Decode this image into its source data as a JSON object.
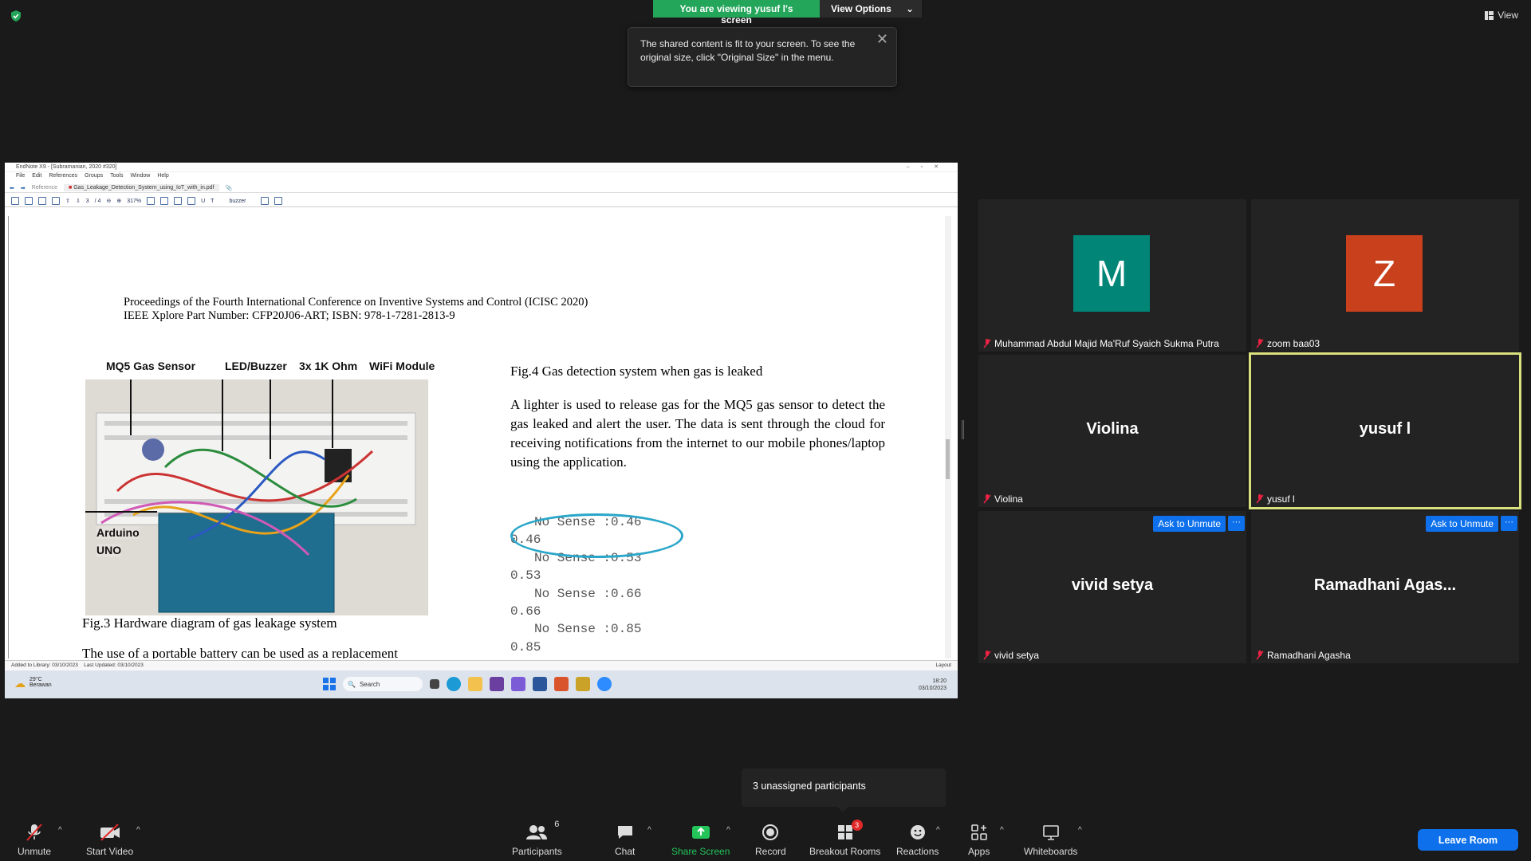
{
  "banner": {
    "viewing": "You are viewing yusuf l's screen",
    "view_options": "View Options"
  },
  "view_label": "View",
  "tooltip": {
    "text": "The shared content is fit to your screen. To see the original size, click \"Original Size\" in the menu."
  },
  "endnote": {
    "title": "EndNote X9 - [Subramanian, 2020 #320]",
    "menu": [
      "File",
      "Edit",
      "References",
      "Groups",
      "Tools",
      "Window",
      "Help"
    ],
    "tab_reference": "Reference",
    "tab_pdf": "Gas_Leakage_Detection_System_using_IoT_with_in.pdf",
    "page_current": "3",
    "page_total": "/ 4",
    "zoom": "317%",
    "search_text": "buzzer",
    "status_added": "Added to Library: 03/10/2023",
    "status_updated": "Last Updated: 03/10/2023",
    "layout": "Layout"
  },
  "pdf": {
    "header_line1": "Proceedings of the Fourth International Conference on Inventive Systems and Control (ICISC 2020)",
    "header_line2": "IEEE Xplore Part Number: CFP20J06-ART; ISBN: 978-1-7281-2813-9",
    "label_mq5": "MQ5 Gas Sensor",
    "label_led": "LED/Buzzer",
    "label_resistor": "3x 1K Ohm",
    "label_wifi": "WiFi Module",
    "label_arduino": "Arduino",
    "label_uno": "UNO",
    "fig3_caption": "Fig.3 Hardware diagram of gas leakage system",
    "fig4_caption": "Fig.4 Gas detection system when gas is leaked",
    "body": "A lighter is used to release gas for the MQ5 gas sensor to detect the gas leaked and alert the user. The data is sent through the cloud for receiving notifications from the internet to our mobile phones/laptop using the application.",
    "bottom_text": "The use of a portable battery can be used as a replacement",
    "serial_lines": [
      "No Sense :0.46",
      "0.46",
      "No Sense :0.53",
      "0.53",
      "No Sense :0.66",
      "0.66",
      "No Sense :0.85",
      "0.85"
    ]
  },
  "taskbar": {
    "temp": "29°C",
    "weather": "Berawan",
    "search": "Search",
    "time": "18:20",
    "date": "03/10/2023"
  },
  "participants": [
    {
      "name": "Muhammad Abdul Majid Ma'Ruf Syaich Sukma Putra",
      "initial": "M",
      "avatar_color": "#008577"
    },
    {
      "name": "zoom baa03",
      "initial": "Z",
      "avatar_color": "#c9401c"
    },
    {
      "name": "Violina",
      "display": "Violina"
    },
    {
      "name": "yusuf l",
      "display": "yusuf l"
    },
    {
      "name": "vivid setya",
      "display": "vivid setya"
    },
    {
      "name": "Ramadhani Agasha",
      "display": "Ramadhani  Agas..."
    }
  ],
  "ask_to_unmute": "Ask to Unmute",
  "more": "···",
  "breakout_popup": "3 unassigned participants",
  "toolbar": {
    "unmute": "Unmute",
    "start_video": "Start Video",
    "participants": "Participants",
    "participants_count": "6",
    "chat": "Chat",
    "share_screen": "Share Screen",
    "record": "Record",
    "breakout_rooms": "Breakout Rooms",
    "breakout_badge": "3",
    "reactions": "Reactions",
    "apps": "Apps",
    "whiteboards": "Whiteboards",
    "leave": "Leave Room"
  },
  "colors": {
    "share_green": "#23a55a",
    "zoom_blue": "#0e71eb",
    "active_speaker": "#d9e07e"
  }
}
